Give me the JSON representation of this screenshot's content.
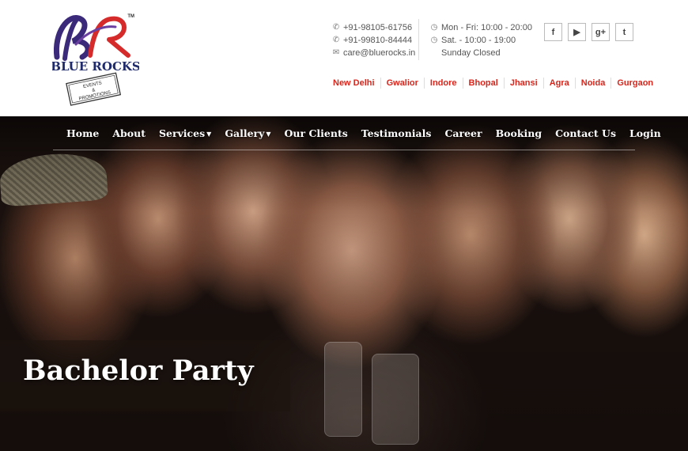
{
  "brand": {
    "name": "BLUE ROCKS",
    "tagline_line1": "EVENTS",
    "tagline_line2": "&",
    "tagline_line3": "PROMOTIONS",
    "trademark": "TM"
  },
  "contact": {
    "phone1": "+91-98105-61756",
    "phone2": "+91-99810-84444",
    "email": "care@bluerocks.in",
    "hours1": "Mon - Fri: 10:00 - 20:00",
    "hours2": "Sat. - 10:00 - 19:00",
    "hours3": "Sunday Closed"
  },
  "social": [
    {
      "icon": "facebook-icon",
      "glyph": "f"
    },
    {
      "icon": "youtube-icon",
      "glyph": "▶"
    },
    {
      "icon": "google-plus-icon",
      "glyph": "g+"
    },
    {
      "icon": "twitter-icon",
      "glyph": "t"
    }
  ],
  "cities": [
    "New Delhi",
    "Gwalior",
    "Indore",
    "Bhopal",
    "Jhansi",
    "Agra",
    "Noida",
    "Gurgaon"
  ],
  "nav": {
    "home": "Home",
    "about": "About",
    "services": "Services",
    "gallery": "Gallery",
    "clients": "Our Clients",
    "testimonials": "Testimonials",
    "career": "Career",
    "booking": "Booking",
    "contact": "Contact Us",
    "login": "Login"
  },
  "hero": {
    "caption": "Bachelor Party"
  },
  "colors": {
    "accent_red": "#d9261c",
    "logo_purple": "#3b2a7a",
    "logo_red": "#d62b2b"
  }
}
